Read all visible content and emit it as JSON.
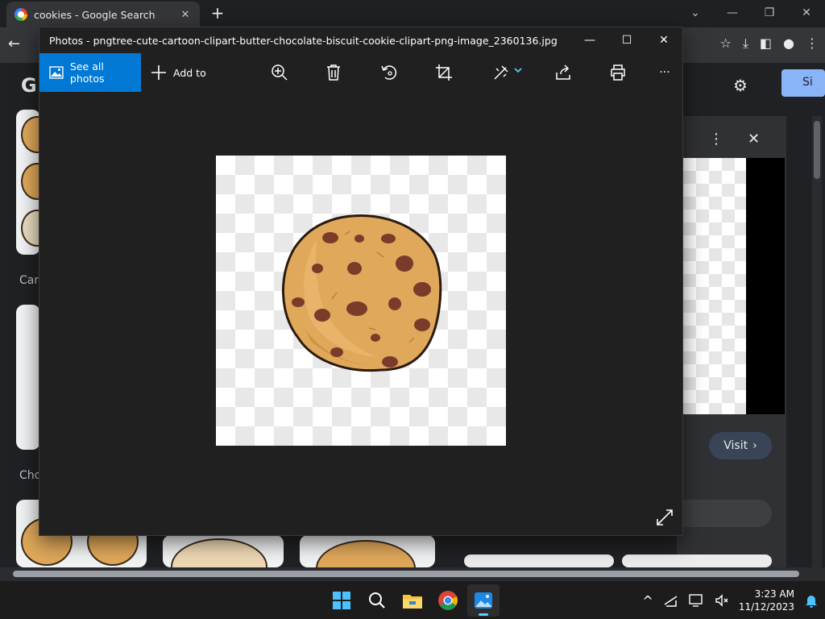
{
  "chrome": {
    "tab_title": "cookies - Google Search",
    "tab_close": "✕",
    "new_tab": "+",
    "minimize": "—",
    "restore": "❐",
    "close": "✕"
  },
  "google": {
    "logo": "G",
    "signin_partial": "Si",
    "captions": [
      "Cart",
      "Cho"
    ],
    "panel_visit": "Visit",
    "panel_more": "⋮",
    "panel_close": "✕"
  },
  "photos": {
    "title": "Photos - pngtree-cute-cartoon-clipart-butter-chocolate-biscuit-cookie-clipart-png-image_2360136.jpg",
    "see_all_label": "See all photos",
    "add_to_label": "Add to",
    "more_label": "···",
    "minimize": "—",
    "maximize": "☐",
    "close": "✕"
  },
  "taskbar": {
    "time": "3:23 AM",
    "date": "11/12/2023",
    "chevron": "^"
  },
  "colors": {
    "accent": "#0078d4",
    "cookie": "#e0a85a",
    "chip": "#7a3b2a"
  }
}
